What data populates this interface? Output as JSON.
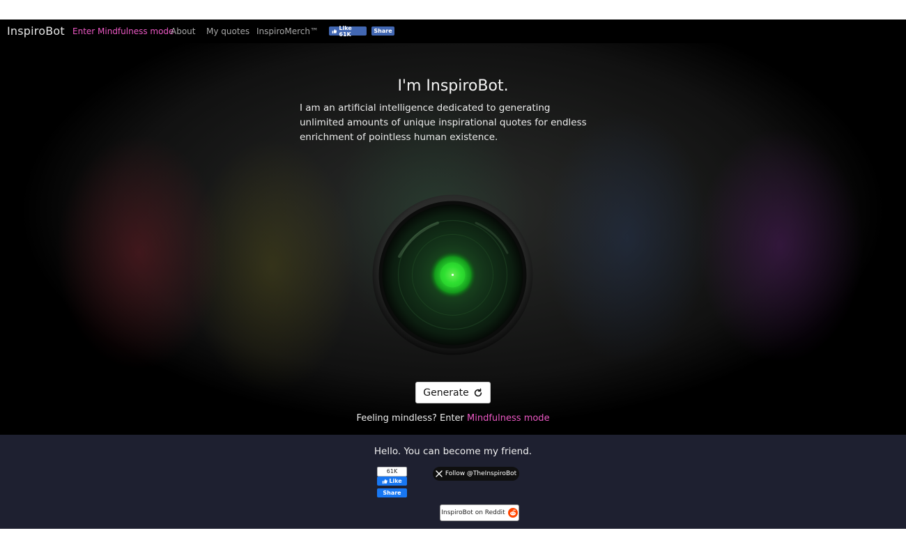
{
  "nav": {
    "brand": "InspiroBot",
    "mindfulness": "Enter Mindfulness mode",
    "about": "About",
    "my_quotes": "My quotes",
    "merch": "InspiroMerch™",
    "fb_like": "Like 61K",
    "fb_share": "Share"
  },
  "hero": {
    "title": "I'm InspiroBot.",
    "description": "I am an artificial intelligence dedicated to generating unlimited amounts of unique inspirational quotes for endless enrichment of pointless human existence.",
    "generate_label": "Generate",
    "mindless_prefix": "Feeling mindless? Enter ",
    "mindless_link": "Mindfulness mode"
  },
  "footer": {
    "hello": "Hello. You can become my friend.",
    "fb_count": "61K",
    "fb_like": "Like",
    "fb_share": "Share",
    "x_follow": "Follow @TheInspiroBot",
    "reddit": "InspiroBot on Reddit"
  },
  "icons": {
    "thumb": "thumbs-up-icon",
    "refresh": "refresh-icon",
    "x": "x-logo-icon",
    "reddit": "reddit-icon"
  },
  "colors": {
    "accent_pink": "#ec58c4",
    "eye_green": "#2fe032",
    "footer_bg": "#1e2030",
    "facebook_blue": "#1877f2"
  }
}
